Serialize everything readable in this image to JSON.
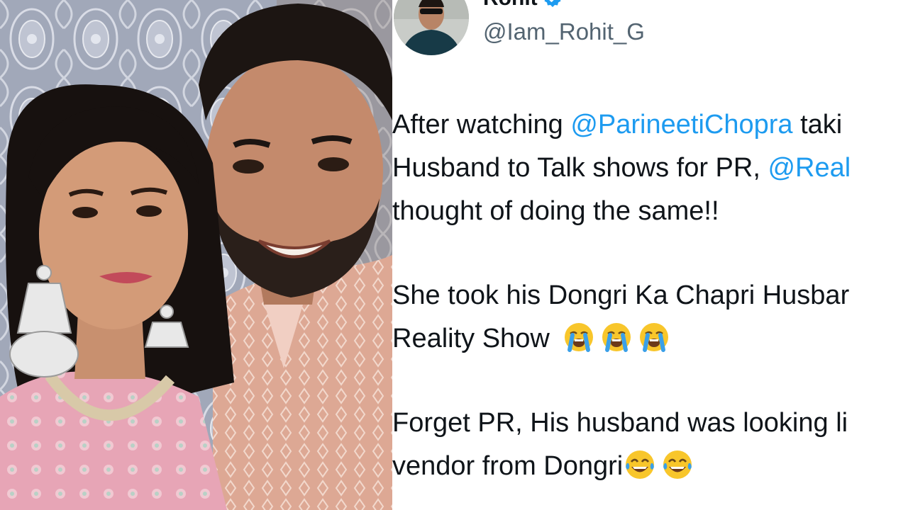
{
  "author": {
    "display_name": "Rohit",
    "handle": "@Iam_Rohit_G",
    "verified": true
  },
  "tweet": {
    "para1": {
      "line1_pre": "After watching ",
      "line1_mention": "@ParineetiChopra",
      "line1_post": " taki",
      "line2_pre": "Husband to Talk shows for PR, ",
      "line2_mention": "@Real",
      "line3": "thought of doing the same!!"
    },
    "para2": {
      "line1": "She took his Dongri Ka Chapri Husbar",
      "line2": "Reality Show"
    },
    "para3": {
      "line1": "Forget PR, His husband was looking li",
      "line2": "vendor from Dongri"
    }
  },
  "emoji": {
    "crying": "loudly-crying-face",
    "laughing": "face-with-tears-of-joy"
  },
  "colors": {
    "mention": "#1d9bf0",
    "text": "#0f1419",
    "handle": "#536471",
    "verified": "#1d9bf0",
    "emoji_yellow": "#f8c62b",
    "emoji_tears": "#3aa0e8"
  }
}
